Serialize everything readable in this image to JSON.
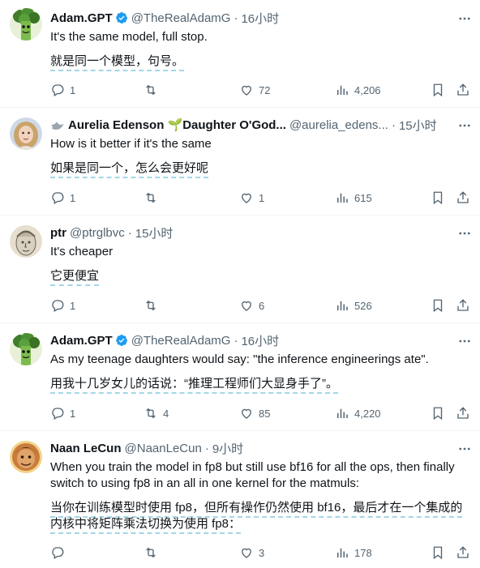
{
  "posts": [
    {
      "name": "Adam.GPT",
      "handle": "@TheRealAdamG",
      "time": "16小时",
      "text": "It's the same model, full stop.",
      "translation": "就是同一个模型，句号。",
      "replies": "1",
      "reposts": "",
      "likes": "72",
      "views": "4,206",
      "avatar": "broccoli"
    },
    {
      "name": "Aurelia Edenson 🌱Daughter O'God...",
      "handle": "@aurelia_edens...",
      "time": "15小时",
      "text": "How is it better if it's the same",
      "translation": "如果是同一个，怎么会更好呢",
      "replies": "1",
      "reposts": "",
      "likes": "1",
      "views": "615",
      "avatar": "woman"
    },
    {
      "name": "ptr",
      "handle": "@ptrglbvc",
      "time": "15小时",
      "text": "It's cheaper",
      "translation": "它更便宜",
      "replies": "1",
      "reposts": "",
      "likes": "6",
      "views": "526",
      "avatar": "statue"
    },
    {
      "name": "Adam.GPT",
      "handle": "@TheRealAdamG",
      "time": "16小时",
      "text": "As my teenage daughters would say: \"the inference engineerings ate\".",
      "translation": "用我十几岁女儿的话说：“推理工程师们大显身手了”。",
      "replies": "1",
      "reposts": "4",
      "likes": "85",
      "views": "4,220",
      "avatar": "broccoli"
    },
    {
      "name": "Naan LeCun",
      "handle": "@NaanLeCun",
      "time": "9小时",
      "text": "When you train the model in fp8 but still use bf16 for all the ops, then finally switch to using fp8 in an all in one kernel for the matmuls:",
      "translation": "当你在训练模型时使用 fp8，但所有操作仍然使用 bf16，最后才在一个集成的内核中将矩阵乘法切换为使用 fp8：",
      "replies": "",
      "reposts": "",
      "likes": "3",
      "views": "178",
      "avatar": "man"
    }
  ],
  "colors": {
    "text": "#0f1419",
    "muted": "#536471",
    "verified": "#1d9bf0",
    "divider": "#eff3f4",
    "translation_underline": "#a3d6e8"
  }
}
